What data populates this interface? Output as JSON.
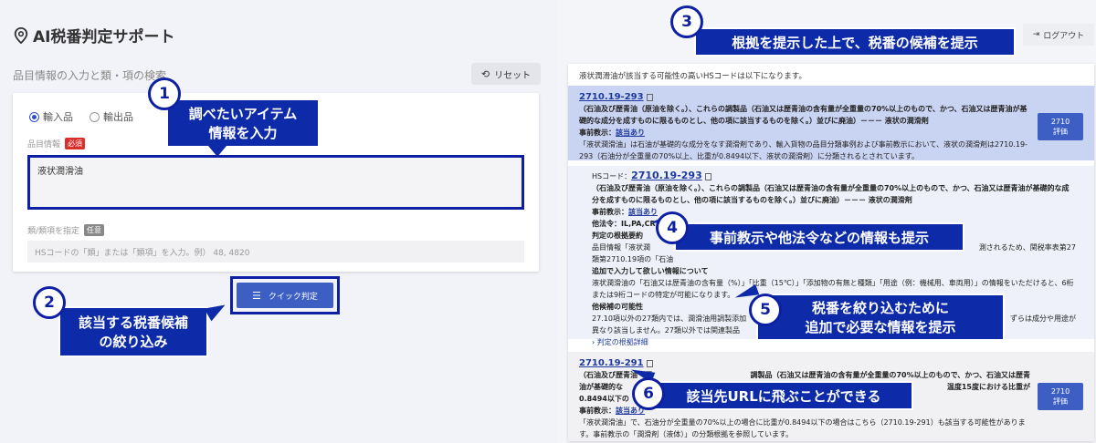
{
  "app": {
    "title": "AI税番判定サポート"
  },
  "left": {
    "section_title": "品目情報の入力と類・項の検索",
    "reset_label": "リセット",
    "import_label": "輸入品",
    "export_label": "輸出品",
    "item_info_label": "品目情報",
    "required_tag": "必須",
    "item_value": "液状潤滑油",
    "hs_label": "類/類項を指定",
    "optional_tag": "任意",
    "hs_placeholder": "HSコードの「類」または「類項」を入力。例） 48, 4820",
    "quick_label": "クイック判定"
  },
  "right": {
    "logout_label": "ログアウト",
    "result_heading": "液状潤滑油が該当する可能性の高いHSコードは以下になります。",
    "r1": {
      "code": "2710.19-293",
      "desc": "（石油及び歴青油（原油を除く。）、これらの調製品（石油又は歴青油の含有量が全重量の70%以上のもので、かつ、石油又は歴青油が基礎的な成分を成すものに限るものとし、他の項に該当するものを除く。）並びに廃油）－－－ 液状の潤滑剤",
      "prior_label": "事前教示：",
      "prior_link": "該当あり",
      "note": "「液状潤滑油」は石油が基礎的な成分をなす潤滑剤であり、輸入貨物の品目分類事例および事前教示において、液状の潤滑剤は2710.19-293（石油分が全重量の70%以上、比重が0.8494以下、液状の潤滑剤）に分類されるとされています。",
      "eval_code": "2710",
      "eval_label": "評価"
    },
    "detail": {
      "hs_label": "HSコード：",
      "code": "2710.19-293",
      "desc": "（石油及び歴青油（原油を除く。）、これらの調製品（石油又は歴青油の含有量が全重量の70%以上のもので、かつ、石油又は歴青油が基礎的な成分を成すものに限るものとし、他の項に該当するものを除く。）並びに廃油）－－－ 液状の潤滑剤",
      "prior_label": "事前教示：",
      "prior_link": "該当あり",
      "other_law": "他法令：IL,PA,CR,IM",
      "basis_title": "判定の根拠要約",
      "basis_text": "品目情報「液状潤",
      "basis_tail": "測されるため、関税率表第27",
      "basis_text2": "類第2710.19項の「石油",
      "addinfo_title": "追加で入力して欲しい情報について",
      "addinfo_text": "液状潤滑油の「石油又は歴青油の含有量（%）」「比重（15℃）」「添加物の有無と種類」「用途（例：機械用、車両用）」の情報をいただけると、6桁または9桁コードの特定が可能になります。",
      "cand_title": "他候補の可能性",
      "cand_text": "27.10項以外の27類内では、潤滑油用調製添加",
      "cand_tail": "ずらは成分や用途が",
      "cand_text2": "異なり該当しません。27類以外では関連製品",
      "more": "判定の根拠詳細"
    },
    "r2": {
      "code": "2710.19-291",
      "desc1": "（石油及び歴青油（原",
      "desc1_tail": "調製品（石油又は歴青油の含有量が全重量の70%以上のもので、かつ、石油又は歴青",
      "desc2": "油が基礎的な",
      "desc2_tail": "温度15度における比重が",
      "desc3": "0.8494以下の",
      "prior_label": "事前教示：",
      "prior_link": "該当あり",
      "note": "「液状潤滑油」で、石油分が全重量の70%以上の場合に比重が0.8494以下の場合はこちら（2710.19-291）も該当する可能性があります。事前教示の「潤滑剤（液体）」の分類根拠を参照しています。",
      "eval_code": "2710",
      "eval_label": "評価"
    }
  },
  "callouts": {
    "c1": {
      "num": "1",
      "line1": "調べたいアイテム",
      "line2": "情報を入力"
    },
    "c2": {
      "num": "2",
      "line1": "該当する税番候補",
      "line2": "の絞り込み"
    },
    "c3": {
      "num": "3",
      "line1": "根拠を提示した上で、税番の候補を提示"
    },
    "c4": {
      "num": "4",
      "line1": "事前教示や他法令などの情報も提示"
    },
    "c5": {
      "num": "5",
      "line1": "税番を絞り込むために",
      "line2": "追加で必要な情報を提示"
    },
    "c6": {
      "num": "6",
      "line1": "該当先URLに飛ぶことができる"
    }
  }
}
